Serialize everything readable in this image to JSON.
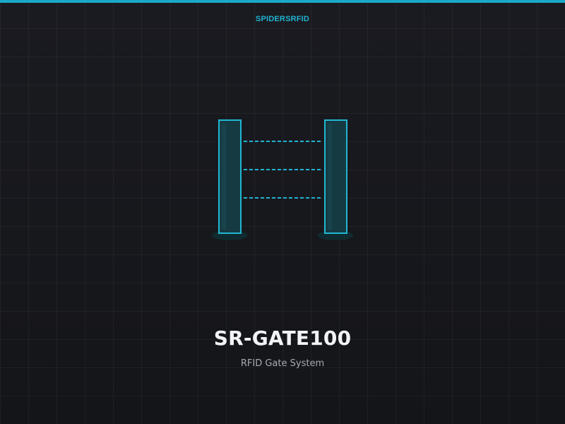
{
  "brand": {
    "name": "SPIDERSRFID"
  },
  "product": {
    "name": "SR-GATE100",
    "subtitle": "RFID Gate System"
  },
  "colors": {
    "accent": "#19a9c8",
    "accent_light": "#20b3d3",
    "background": "#17181c",
    "title": "#f1f3f5",
    "subtitle": "#a7abb2"
  },
  "icons": {
    "illustration": "rfid-gate-icon"
  }
}
